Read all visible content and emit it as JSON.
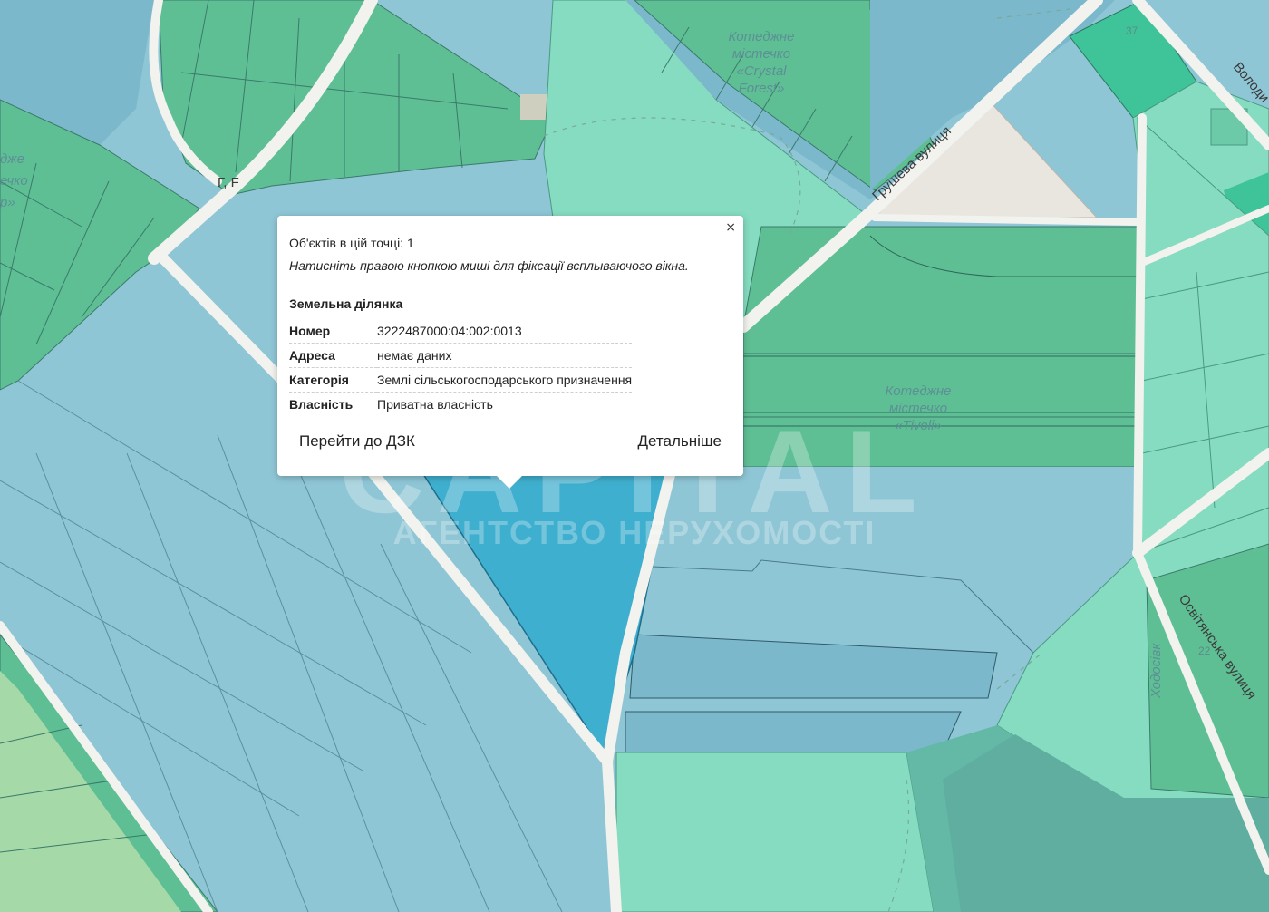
{
  "map": {
    "labels": {
      "crystal_1": "Котеджне",
      "crystal_2": "містечко",
      "crystal_3": "«Crystal",
      "crystal_4": "Forest»",
      "tivoli_1": "Котеджне",
      "tivoli_2": "містечко",
      "tivoli_3": "«Tivoli»",
      "left_1": "дже",
      "left_2": "ечко",
      "left_3": "р»"
    },
    "streets": {
      "grusheva": "Грушева вулиця",
      "osvitianska": "Освітянська вулиця",
      "volody": "Володи",
      "hodosivka": "Ходосівк"
    },
    "house_numbers": [
      "37",
      "22"
    ],
    "road_marker": "Г, F",
    "colors": {
      "parcel_private": "#8fc6d6",
      "parcel_green": "#5fbf94",
      "parcel_mint": "#86dcc0",
      "parcel_selected": "#3fafcf",
      "road": "#f2f2ee"
    }
  },
  "watermark": {
    "brand": "CAPITAL",
    "subtitle": "АГЕНТСТВО НЕРУХОМОСТІ"
  },
  "popup": {
    "close": "×",
    "count_text": "Об'єктів в цій точці: 1",
    "hint": "Натисніть правою кнопкою миші для фіксації всплываючого вікна.",
    "section_title": "Земельна ділянка",
    "rows": [
      {
        "key": "Номер",
        "value": "3222487000:04:002:0013"
      },
      {
        "key": "Адреса",
        "value": "немає даних"
      },
      {
        "key": "Категорія",
        "value": "Землі сільськогосподарського призначення"
      },
      {
        "key": "Власність",
        "value": "Приватна власність"
      }
    ],
    "button_dzk": "Перейти до ДЗК",
    "button_detail": "Детальніше"
  }
}
